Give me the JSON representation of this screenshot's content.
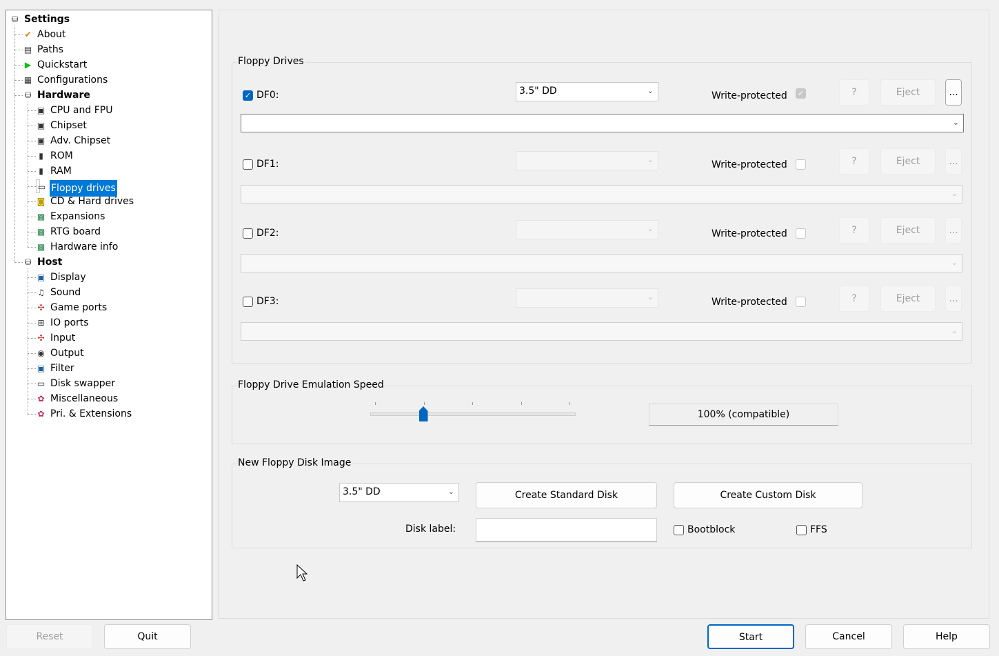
{
  "tree": [
    {
      "label": "Settings",
      "icon": "settings-icon",
      "level": 0,
      "bold": true
    },
    {
      "label": "About",
      "icon": "checkmark-icon",
      "level": 1
    },
    {
      "label": "Paths",
      "icon": "paths-icon",
      "level": 1
    },
    {
      "label": "Quickstart",
      "icon": "play-icon",
      "level": 1
    },
    {
      "label": "Configurations",
      "icon": "configurations-icon",
      "level": 1
    },
    {
      "label": "Hardware",
      "icon": "hardware-icon",
      "level": 1,
      "bold": true
    },
    {
      "label": "CPU and FPU",
      "icon": "chip-icon",
      "level": 2
    },
    {
      "label": "Chipset",
      "icon": "chip-icon",
      "level": 2
    },
    {
      "label": "Adv. Chipset",
      "icon": "chip-icon",
      "level": 2
    },
    {
      "label": "ROM",
      "icon": "memory-icon",
      "level": 2
    },
    {
      "label": "RAM",
      "icon": "memory-icon",
      "level": 2
    },
    {
      "label": "Floppy drives",
      "icon": "floppy-icon",
      "level": 2,
      "selected": true
    },
    {
      "label": "CD & Hard drives",
      "icon": "harddrive-icon",
      "level": 2
    },
    {
      "label": "Expansions",
      "icon": "board-icon",
      "level": 2
    },
    {
      "label": "RTG board",
      "icon": "board-icon",
      "level": 2
    },
    {
      "label": "Hardware info",
      "icon": "board-icon",
      "level": 2
    },
    {
      "label": "Host",
      "icon": "host-icon",
      "level": 1,
      "bold": true
    },
    {
      "label": "Display",
      "icon": "display-icon",
      "level": 2
    },
    {
      "label": "Sound",
      "icon": "sound-icon",
      "level": 2
    },
    {
      "label": "Game ports",
      "icon": "joystick-icon",
      "level": 2
    },
    {
      "label": "IO ports",
      "icon": "port-icon",
      "level": 2
    },
    {
      "label": "Input",
      "icon": "joystick-icon",
      "level": 2
    },
    {
      "label": "Output",
      "icon": "output-icon",
      "level": 2
    },
    {
      "label": "Filter",
      "icon": "display-icon",
      "level": 2
    },
    {
      "label": "Disk swapper",
      "icon": "floppy-icon",
      "level": 2
    },
    {
      "label": "Miscellaneous",
      "icon": "misc-icon",
      "level": 2
    },
    {
      "label": "Pri. & Extensions",
      "icon": "misc-icon",
      "level": 2
    }
  ],
  "floppy": {
    "title": "Floppy Drives",
    "write_protected_label": "Write-protected",
    "help_label": "?",
    "eject_label": "Eject",
    "browse_label": "...",
    "drives": [
      {
        "name": "DF0:",
        "enabled": true,
        "type": "3.5\" DD",
        "write_protected": true,
        "path": ""
      },
      {
        "name": "DF1:",
        "enabled": false,
        "type": "",
        "write_protected": false,
        "path": ""
      },
      {
        "name": "DF2:",
        "enabled": false,
        "type": "",
        "write_protected": false,
        "path": ""
      },
      {
        "name": "DF3:",
        "enabled": false,
        "type": "",
        "write_protected": false,
        "path": ""
      }
    ]
  },
  "speed": {
    "title": "Floppy Drive Emulation Speed",
    "value_label": "100% (compatible)",
    "slider_position": 0.25,
    "tick_count": 5
  },
  "newdisk": {
    "title": "New Floppy Disk Image",
    "type": "3.5\" DD",
    "create_standard": "Create Standard Disk",
    "create_custom": "Create Custom Disk",
    "disk_label": "Disk label:",
    "disk_label_value": "",
    "bootblock": "Bootblock",
    "ffs": "FFS",
    "bootblock_checked": false,
    "ffs_checked": false
  },
  "footer": {
    "reset": "Reset",
    "quit": "Quit",
    "start": "Start",
    "cancel": "Cancel",
    "help": "Help"
  },
  "colors": {
    "accent": "#0078d7",
    "slider": "#0067c0"
  }
}
